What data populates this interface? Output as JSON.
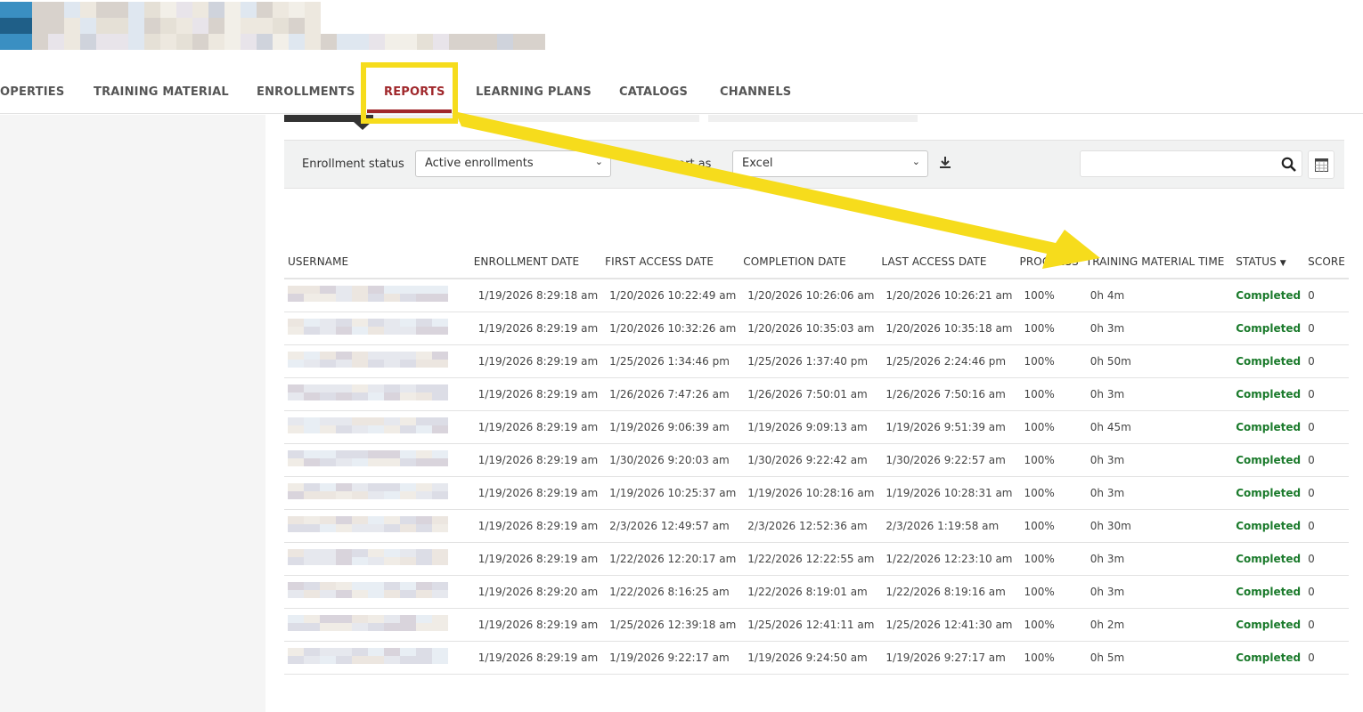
{
  "tabs": [
    {
      "label": "OPERTIES",
      "active": false
    },
    {
      "label": "TRAINING MATERIAL",
      "active": false
    },
    {
      "label": "ENROLLMENTS",
      "active": false
    },
    {
      "label": "REPORTS",
      "active": true
    },
    {
      "label": "LEARNING PLANS",
      "active": false
    },
    {
      "label": "CATALOGS",
      "active": false
    },
    {
      "label": "CHANNELS",
      "active": false
    }
  ],
  "filters": {
    "enrollment_status_label": "Enrollment status",
    "enrollment_status_value": "Active enrollments",
    "export_label": "Export as",
    "export_value": "Excel",
    "search_value": ""
  },
  "table": {
    "headers": [
      "USERNAME",
      "ENROLLMENT DATE",
      "FIRST ACCESS DATE",
      "COMPLETION DATE",
      "LAST ACCESS DATE",
      "PROGRESS",
      "TRAINING MATERIAL TIME",
      "STATUS",
      "SCORE"
    ],
    "rows": [
      [
        "1/19/2026 8:29:18 am",
        "1/20/2026 10:22:49 am",
        "1/20/2026 10:26:06 am",
        "1/20/2026 10:26:21 am",
        "100%",
        "0h 4m",
        "Completed",
        "0"
      ],
      [
        "1/19/2026 8:29:19 am",
        "1/20/2026 10:32:26 am",
        "1/20/2026 10:35:03 am",
        "1/20/2026 10:35:18 am",
        "100%",
        "0h 3m",
        "Completed",
        "0"
      ],
      [
        "1/19/2026 8:29:19 am",
        "1/25/2026 1:34:46 pm",
        "1/25/2026 1:37:40 pm",
        "1/25/2026 2:24:46 pm",
        "100%",
        "0h 50m",
        "Completed",
        "0"
      ],
      [
        "1/19/2026 8:29:19 am",
        "1/26/2026 7:47:26 am",
        "1/26/2026 7:50:01 am",
        "1/26/2026 7:50:16 am",
        "100%",
        "0h 3m",
        "Completed",
        "0"
      ],
      [
        "1/19/2026 8:29:19 am",
        "1/19/2026 9:06:39 am",
        "1/19/2026 9:09:13 am",
        "1/19/2026 9:51:39 am",
        "100%",
        "0h 45m",
        "Completed",
        "0"
      ],
      [
        "1/19/2026 8:29:19 am",
        "1/30/2026 9:20:03 am",
        "1/30/2026 9:22:42 am",
        "1/30/2026 9:22:57 am",
        "100%",
        "0h 3m",
        "Completed",
        "0"
      ],
      [
        "1/19/2026 8:29:19 am",
        "1/19/2026 10:25:37 am",
        "1/19/2026 10:28:16 am",
        "1/19/2026 10:28:31 am",
        "100%",
        "0h 3m",
        "Completed",
        "0"
      ],
      [
        "1/19/2026 8:29:19 am",
        "2/3/2026 12:49:57 am",
        "2/3/2026 12:52:36 am",
        "2/3/2026 1:19:58 am",
        "100%",
        "0h 30m",
        "Completed",
        "0"
      ],
      [
        "1/19/2026 8:29:19 am",
        "1/22/2026 12:20:17 am",
        "1/22/2026 12:22:55 am",
        "1/22/2026 12:23:10 am",
        "100%",
        "0h 3m",
        "Completed",
        "0"
      ],
      [
        "1/19/2026 8:29:20 am",
        "1/22/2026 8:16:25 am",
        "1/22/2026 8:19:01 am",
        "1/22/2026 8:19:16 am",
        "100%",
        "0h 3m",
        "Completed",
        "0"
      ],
      [
        "1/19/2026 8:29:19 am",
        "1/25/2026 12:39:18 am",
        "1/25/2026 12:41:11 am",
        "1/25/2026 12:41:30 am",
        "100%",
        "0h 2m",
        "Completed",
        "0"
      ],
      [
        "1/19/2026 8:29:19 am",
        "1/19/2026 9:22:17 am",
        "1/19/2026 9:24:50 am",
        "1/19/2026 9:27:17 am",
        "100%",
        "0h 5m",
        "Completed",
        "0"
      ]
    ]
  },
  "colors": {
    "accent": "#a0282c",
    "completed": "#1a7a2b",
    "highlight": "#f6dc1c"
  }
}
